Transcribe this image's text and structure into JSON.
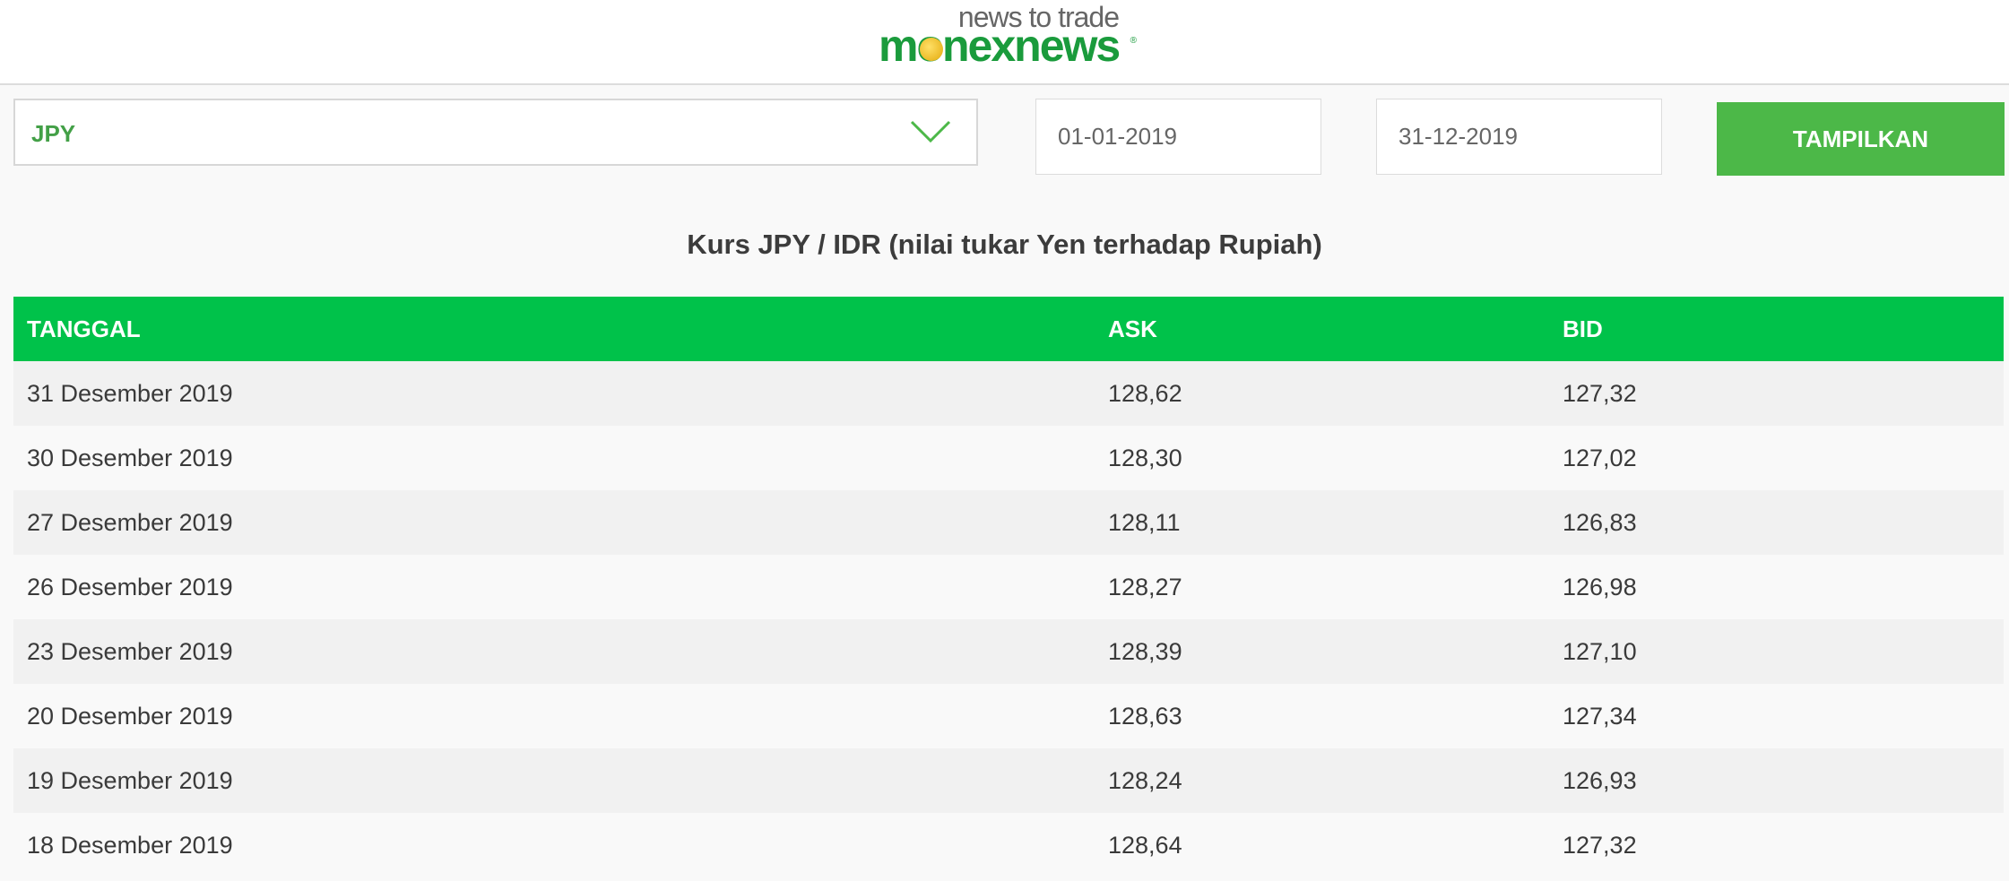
{
  "header": {
    "tagline": "news to trade",
    "brand_prefix": "m",
    "brand_o": "o",
    "brand_suffix": "nexnews",
    "registered": "®"
  },
  "filters": {
    "currency": {
      "selected": "JPY",
      "icon": "chevron-down-icon"
    },
    "start_date": "01-01-2019",
    "end_date": "31-12-2019",
    "submit_label": "TAMPILKAN"
  },
  "title": "Kurs JPY / IDR (nilai tukar Yen terhadap Rupiah)",
  "table": {
    "columns": [
      "TANGGAL",
      "ASK",
      "BID"
    ],
    "rows": [
      {
        "date": "31 Desember 2019",
        "ask": "128,62",
        "bid": "127,32"
      },
      {
        "date": "30 Desember 2019",
        "ask": "128,30",
        "bid": "127,02"
      },
      {
        "date": "27 Desember 2019",
        "ask": "128,11",
        "bid": "126,83"
      },
      {
        "date": "26 Desember 2019",
        "ask": "128,27",
        "bid": "126,98"
      },
      {
        "date": "23 Desember 2019",
        "ask": "128,39",
        "bid": "127,10"
      },
      {
        "date": "20 Desember 2019",
        "ask": "128,63",
        "bid": "127,34"
      },
      {
        "date": "19 Desember 2019",
        "ask": "128,24",
        "bid": "126,93"
      },
      {
        "date": "18 Desember 2019",
        "ask": "128,64",
        "bid": "127,32"
      }
    ]
  },
  "colors": {
    "brand_green": "#1a9b3c",
    "header_green": "#00c24a",
    "button_green": "#4cb848",
    "select_text": "#43a047"
  }
}
